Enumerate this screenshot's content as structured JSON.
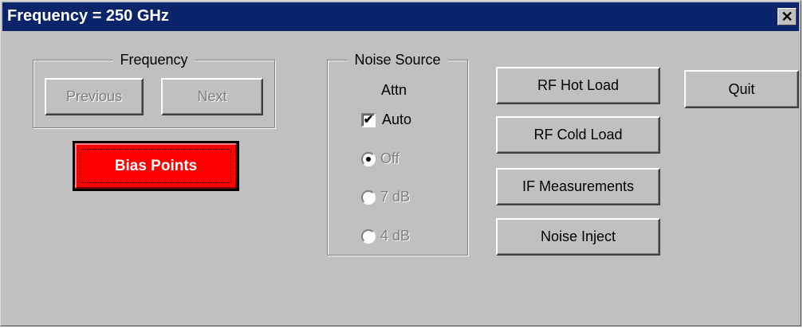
{
  "window": {
    "title": "Frequency = 250 GHz",
    "close_glyph": "✕"
  },
  "frequency_group": {
    "legend": "Frequency",
    "previous_label": "Previous",
    "next_label": "Next",
    "previous_enabled": false,
    "next_enabled": false
  },
  "bias_points": {
    "label": "Bias Points",
    "color": "#ff0000"
  },
  "noise_source": {
    "legend": "Noise Source",
    "attn_label": "Attn",
    "auto": {
      "label": "Auto",
      "checked": true,
      "check_glyph": "✔"
    },
    "options": [
      {
        "label": "Off",
        "selected": true
      },
      {
        "label": "7 dB",
        "selected": false
      },
      {
        "label": "4 dB",
        "selected": false
      }
    ],
    "options_enabled": false
  },
  "actions": {
    "rf_hot_load": "RF Hot Load",
    "rf_cold_load": "RF Cold Load",
    "if_measurements": "IF Measurements",
    "noise_inject": "Noise Inject",
    "quit": "Quit"
  },
  "colors": {
    "titlebar": "#0a246a",
    "face": "#c0c0c0",
    "accent": "#ff0000"
  }
}
